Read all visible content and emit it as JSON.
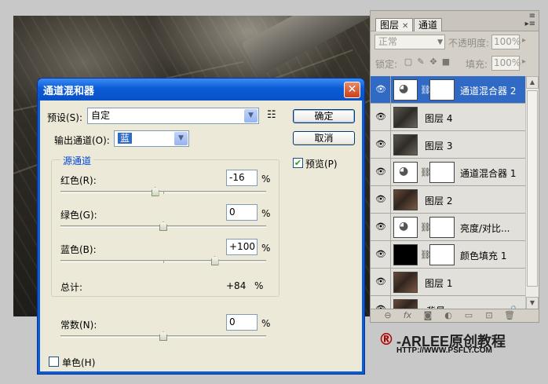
{
  "dialog": {
    "title": "通道混和器",
    "close": "✕",
    "preset_label": "预设(S):",
    "preset_value": "自定",
    "output_label": "输出通道(O):",
    "output_value": "蓝",
    "ok": "确定",
    "cancel": "取消",
    "preview_label": "预览(P)",
    "preview_checked": true,
    "source_group": "源通道",
    "red_label": "红色(R):",
    "red_value": "-16",
    "green_label": "绿色(G):",
    "green_value": "0",
    "blue_label": "蓝色(B):",
    "blue_value": "+100",
    "total_label": "总计:",
    "total_value": "+84",
    "percent": "%",
    "constant_label": "常数(N):",
    "constant_value": "0",
    "mono_label": "单色(H)",
    "mono_checked": false,
    "sliders": {
      "red": -16,
      "green": 0,
      "blue": 100,
      "constant": 0,
      "min": -200,
      "max": 200
    }
  },
  "panel": {
    "tabs": [
      "图层",
      "通道"
    ],
    "blend_mode": "正常",
    "opacity_label": "不透明度:",
    "opacity_value": "100%",
    "lock_label": "锁定:",
    "fill_label": "填充:",
    "fill_value": "100%",
    "layers": [
      {
        "name": "通道混合器 2",
        "type": "adjustment",
        "selected": true
      },
      {
        "name": "图层 4",
        "type": "photo"
      },
      {
        "name": "图层 3",
        "type": "photo"
      },
      {
        "name": "通道混合器 1",
        "type": "adjustment"
      },
      {
        "name": "图层 2",
        "type": "photo-color"
      },
      {
        "name": "亮度/对比...",
        "type": "adjustment"
      },
      {
        "name": "颜色填充 1",
        "type": "fill"
      },
      {
        "name": "图层 1",
        "type": "photo-color"
      },
      {
        "name": "背景",
        "type": "background"
      }
    ]
  },
  "watermark": {
    "logo": "®",
    "text": "-ARLEE原创教程",
    "url": "HTTP://WWW.PSFLY.COM"
  }
}
